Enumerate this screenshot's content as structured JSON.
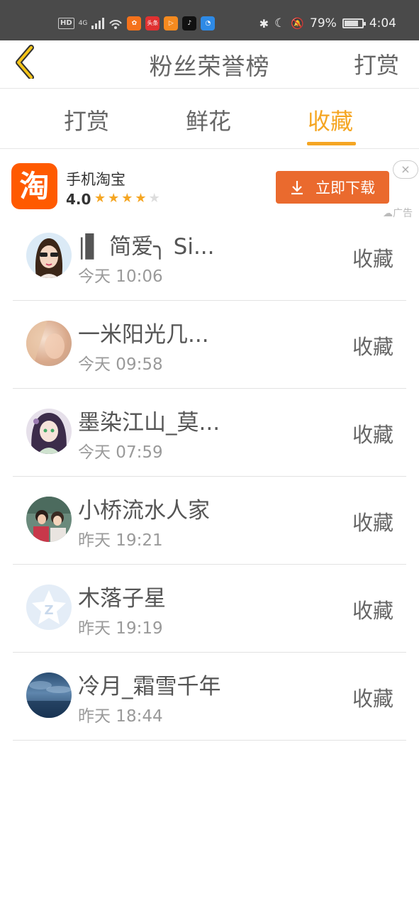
{
  "status_bar": {
    "network_hd": "HD",
    "network_type": "4G",
    "battery_percent": "79%",
    "battery_level": 0.79,
    "time": "4:04",
    "app_icons": [
      {
        "name": "app-icon-1",
        "color": "#f5721b"
      },
      {
        "name": "toutiao-icon",
        "color": "#e03131",
        "label": "头条"
      },
      {
        "name": "app-icon-3",
        "color": "#f58a1f"
      },
      {
        "name": "tiktok-icon",
        "color": "#111111"
      },
      {
        "name": "app-icon-5",
        "color": "#2e8ae6"
      }
    ]
  },
  "header": {
    "title": "粉丝荣誉榜",
    "action_label": "打赏",
    "accent_color": "#f5a623"
  },
  "tabs": [
    {
      "label": "打赏",
      "active": false
    },
    {
      "label": "鲜花",
      "active": false
    },
    {
      "label": "收藏",
      "active": true
    }
  ],
  "ad": {
    "app_name": "手机淘宝",
    "logo_char": "淘",
    "rating": "4.0",
    "stars": 4,
    "button_label": "立即下载",
    "close_label": "×",
    "tag": "广告"
  },
  "list": [
    {
      "name": "|▌ 简爱╮ Si...",
      "time": "今天 10:06",
      "action": "收藏",
      "avatar": "avatar-girl-sunglasses"
    },
    {
      "name": "一米阳光几...",
      "time": "今天 09:58",
      "action": "收藏",
      "avatar": "avatar-blurred-face"
    },
    {
      "name": "墨染江山_莫...",
      "time": "今天 07:59",
      "action": "收藏",
      "avatar": "avatar-anime-girl"
    },
    {
      "name": "小桥流水人家",
      "time": "昨天 19:21",
      "action": "收藏",
      "avatar": "avatar-couple"
    },
    {
      "name": "木落子星",
      "time": "昨天 19:19",
      "action": "收藏",
      "avatar": "avatar-default-star"
    },
    {
      "name": "冷月_霜雪千年",
      "time": "昨天 18:44",
      "action": "收藏",
      "avatar": "avatar-blue-landscape"
    }
  ]
}
